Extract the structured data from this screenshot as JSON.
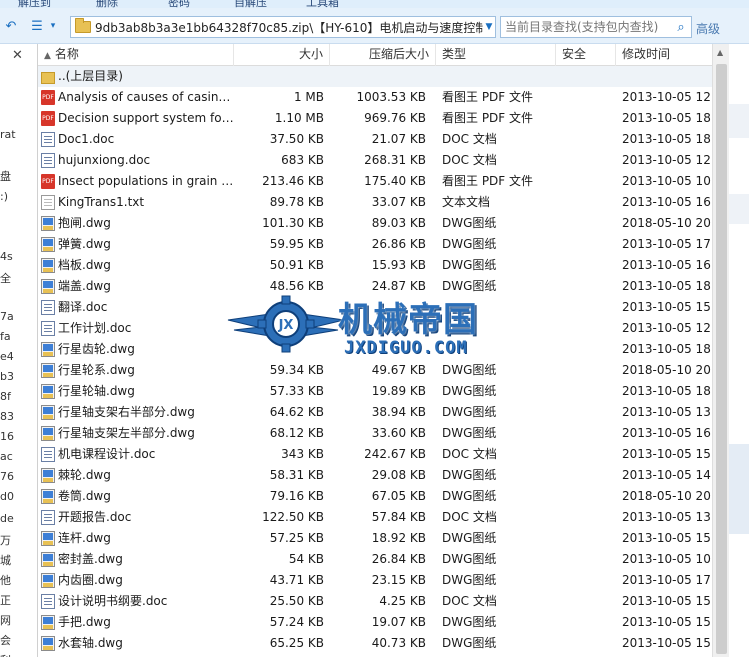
{
  "toolbar": {
    "labels": [
      "解压到",
      "删除",
      "密码",
      "自解压",
      "工具箱"
    ]
  },
  "address": {
    "path": "9db3ab8b3a3e1bb64328f70c85.zip\\【HY-610】电机启动与速度控制"
  },
  "search": {
    "placeholder": "当前目录查找(支持包内查找)",
    "advanced_label": "高级"
  },
  "left_pane": {
    "fragments": [
      "rat",
      "盘",
      ":)",
      "4s",
      "全",
      "7a",
      "fa",
      "e4",
      "b3",
      "8f",
      "83",
      "16",
      "ac",
      "76",
      "d0",
      "de",
      "万",
      "城",
      "他",
      "正",
      "网",
      "会",
      "利"
    ]
  },
  "columns": {
    "name": "名称",
    "size": "大小",
    "compressed": "压缩后大小",
    "type": "类型",
    "security": "安全",
    "modified": "修改时间"
  },
  "parent_dir": "..(上层目录)",
  "files": [
    {
      "icon": "pdf",
      "name": "Analysis of causes of casing...",
      "size": "1 MB",
      "compressed": "1003.53 KB",
      "type": "看图王 PDF 文件",
      "modified": "2013-10-05 12:"
    },
    {
      "icon": "pdf",
      "name": "Decision support system for...",
      "size": "1.10 MB",
      "compressed": "969.76 KB",
      "type": "看图王 PDF 文件",
      "modified": "2013-10-05 18:"
    },
    {
      "icon": "doc",
      "name": "Doc1.doc",
      "size": "37.50 KB",
      "compressed": "21.07 KB",
      "type": "DOC 文档",
      "modified": "2013-10-05 18:"
    },
    {
      "icon": "doc",
      "name": "hujunxiong.doc",
      "size": "683 KB",
      "compressed": "268.31 KB",
      "type": "DOC 文档",
      "modified": "2013-10-05 12:"
    },
    {
      "icon": "pdf",
      "name": "Insect populations in grain r...",
      "size": "213.46 KB",
      "compressed": "175.40 KB",
      "type": "看图王 PDF 文件",
      "modified": "2013-10-05 10:"
    },
    {
      "icon": "txt",
      "name": "KingTrans1.txt",
      "size": "89.78 KB",
      "compressed": "33.07 KB",
      "type": "文本文档",
      "modified": "2013-10-05 16:"
    },
    {
      "icon": "dwg",
      "name": "抱闸.dwg",
      "size": "101.30 KB",
      "compressed": "89.03 KB",
      "type": "DWG图纸",
      "modified": "2018-05-10 20:"
    },
    {
      "icon": "dwg",
      "name": "弹簧.dwg",
      "size": "59.95 KB",
      "compressed": "26.86 KB",
      "type": "DWG图纸",
      "modified": "2013-10-05 17:"
    },
    {
      "icon": "dwg",
      "name": "档板.dwg",
      "size": "50.91 KB",
      "compressed": "15.93 KB",
      "type": "DWG图纸",
      "modified": "2013-10-05 16:"
    },
    {
      "icon": "dwg",
      "name": "端盖.dwg",
      "size": "48.56 KB",
      "compressed": "24.87 KB",
      "type": "DWG图纸",
      "modified": "2013-10-05 18:"
    },
    {
      "icon": "doc",
      "name": "翻译.doc",
      "size": "",
      "compressed": "",
      "type": "",
      "modified": "2013-10-05 15:"
    },
    {
      "icon": "doc",
      "name": "工作计划.doc",
      "size": "",
      "compressed": "",
      "type": "",
      "modified": "2013-10-05 12:"
    },
    {
      "icon": "dwg",
      "name": "行星齿轮.dwg",
      "size": "",
      "compressed": "",
      "type": "",
      "modified": "2013-10-05 18:"
    },
    {
      "icon": "dwg",
      "name": "行星轮系.dwg",
      "size": "59.34 KB",
      "compressed": "49.67 KB",
      "type": "DWG图纸",
      "modified": "2018-05-10 20:"
    },
    {
      "icon": "dwg",
      "name": "行星轮轴.dwg",
      "size": "57.33 KB",
      "compressed": "19.89 KB",
      "type": "DWG图纸",
      "modified": "2013-10-05 18:"
    },
    {
      "icon": "dwg",
      "name": "行星轴支架右半部分.dwg",
      "size": "64.62 KB",
      "compressed": "38.94 KB",
      "type": "DWG图纸",
      "modified": "2013-10-05 13:"
    },
    {
      "icon": "dwg",
      "name": "行星轴支架左半部分.dwg",
      "size": "68.12 KB",
      "compressed": "33.60 KB",
      "type": "DWG图纸",
      "modified": "2013-10-05 16:"
    },
    {
      "icon": "doc",
      "name": "机电课程设计.doc",
      "size": "343 KB",
      "compressed": "242.67 KB",
      "type": "DOC 文档",
      "modified": "2013-10-05 15:"
    },
    {
      "icon": "dwg",
      "name": "棘轮.dwg",
      "size": "58.31 KB",
      "compressed": "29.08 KB",
      "type": "DWG图纸",
      "modified": "2013-10-05 14:"
    },
    {
      "icon": "dwg",
      "name": "卷筒.dwg",
      "size": "79.16 KB",
      "compressed": "67.05 KB",
      "type": "DWG图纸",
      "modified": "2018-05-10 20:"
    },
    {
      "icon": "doc",
      "name": "开题报告.doc",
      "size": "122.50 KB",
      "compressed": "57.84 KB",
      "type": "DOC 文档",
      "modified": "2013-10-05 13:"
    },
    {
      "icon": "dwg",
      "name": "连杆.dwg",
      "size": "57.25 KB",
      "compressed": "18.92 KB",
      "type": "DWG图纸",
      "modified": "2013-10-05 15:"
    },
    {
      "icon": "dwg",
      "name": "密封盖.dwg",
      "size": "54 KB",
      "compressed": "26.84 KB",
      "type": "DWG图纸",
      "modified": "2013-10-05 10:"
    },
    {
      "icon": "dwg",
      "name": "内齿圈.dwg",
      "size": "43.71 KB",
      "compressed": "23.15 KB",
      "type": "DWG图纸",
      "modified": "2013-10-05 17:"
    },
    {
      "icon": "doc",
      "name": "设计说明书纲要.doc",
      "size": "25.50 KB",
      "compressed": "4.25 KB",
      "type": "DOC 文档",
      "modified": "2013-10-05 15:"
    },
    {
      "icon": "dwg",
      "name": "手把.dwg",
      "size": "57.24 KB",
      "compressed": "19.07 KB",
      "type": "DWG图纸",
      "modified": "2013-10-05 15:"
    },
    {
      "icon": "dwg",
      "name": "水套轴.dwg",
      "size": "65.25 KB",
      "compressed": "40.73 KB",
      "type": "DWG图纸",
      "modified": "2013-10-05 15:"
    }
  ],
  "watermark": {
    "title": "机械帝国",
    "subtitle": "JXDIGUO.COM"
  },
  "colors": {
    "accent": "#1a6fc1",
    "watermark": "#2c6fb8",
    "toolbar_bg": "#e6f1fb"
  }
}
